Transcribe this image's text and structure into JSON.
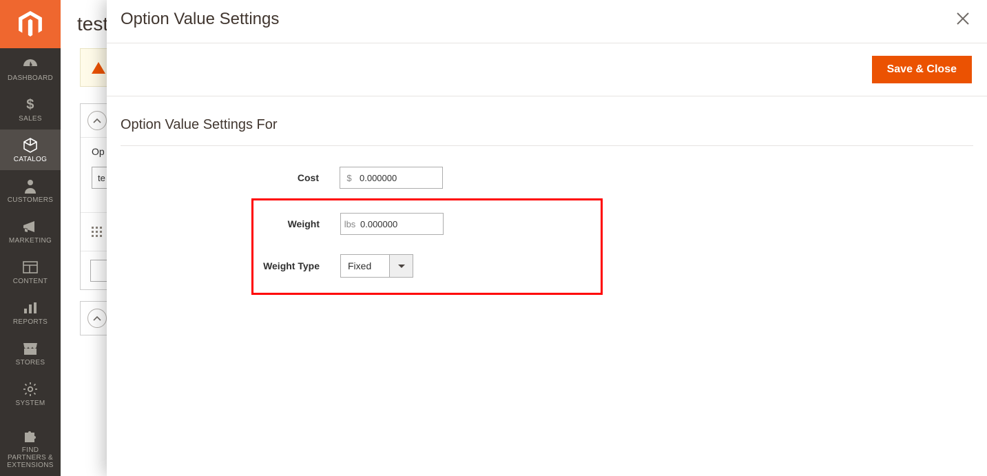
{
  "sidebar": {
    "items": [
      {
        "label": "DASHBOARD"
      },
      {
        "label": "SALES"
      },
      {
        "label": "CATALOG"
      },
      {
        "label": "CUSTOMERS"
      },
      {
        "label": "MARKETING"
      },
      {
        "label": "CONTENT"
      },
      {
        "label": "REPORTS"
      },
      {
        "label": "STORES"
      },
      {
        "label": "SYSTEM"
      },
      {
        "label": "FIND PARTNERS & EXTENSIONS"
      }
    ]
  },
  "page": {
    "title_fragment": "test",
    "panel1_label_fragment": "Op",
    "panel1_input_fragment": "te"
  },
  "modal": {
    "title": "Option Value Settings",
    "save_close_label": "Save & Close",
    "subtitle": "Option Value Settings For",
    "cost": {
      "label": "Cost",
      "prefix": "$",
      "value": "0.000000"
    },
    "weight": {
      "label": "Weight",
      "prefix": "lbs",
      "value": "0.000000"
    },
    "weight_type": {
      "label": "Weight Type",
      "value": "Fixed"
    }
  }
}
